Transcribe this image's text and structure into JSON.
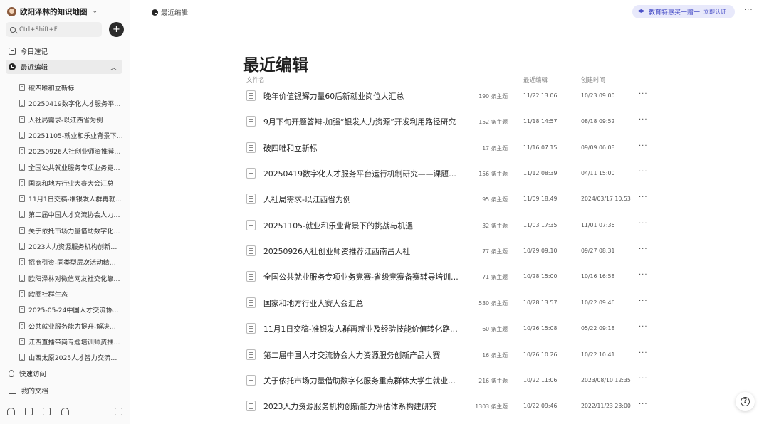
{
  "sidebar": {
    "workspace_name": "欧阳泽林的知识地图",
    "search_placeholder": "Ctrl+Shift+F",
    "add_label": "+",
    "nav": {
      "today": "今日速记",
      "recent": "最近编辑"
    },
    "tree": [
      "破四唯和立新标",
      "20250419数字化人才服务平…",
      "人社局需求-以江西省为例",
      "20251105-就业和乐业背景下…",
      "20250926人社创业师资推荐…",
      "全国公共就业服务专项业务竞…",
      "国家和地方行业大赛大会汇总",
      "11月1日交稿-准银发人群再就…",
      "第二届中国人才交流协会人力…",
      "关于依托市场力量借助数字化…",
      "2023人力资源服务机构创新…",
      "招商引资-同类型层次活动精…",
      "欧阳泽林对微信网友社交化靠…",
      "欧圈社群生态",
      "2025-05-24中国人才交流协…",
      "公共就业服务能力提升-解决…",
      "江西直播带岗专题培训师资推…",
      "山西太原2025人才智力交流…"
    ],
    "quick_access": "快速访问",
    "my_docs": "我的文档"
  },
  "header": {
    "breadcrumb": "最近编辑",
    "promo_text": "教育特惠买一赠一",
    "promo_cta": "立即认证",
    "more": "···"
  },
  "main": {
    "title": "最近编辑",
    "columns": {
      "name": "文件名",
      "edited": "最近编辑",
      "created": "创建时间"
    },
    "rows": [
      {
        "name": "晚年价值银辉力量60后新就业岗位大汇总",
        "count": "190 条主题",
        "edited": "11/22 13:06",
        "created": "10/23 09:00"
      },
      {
        "name": "9月下旬开题答辩-加强“银发人力资源”开发利用路径研究",
        "count": "152 条主题",
        "edited": "11/18 14:57",
        "created": "08/18 09:52"
      },
      {
        "name": "破四唯和立新标",
        "count": "17 条主题",
        "edited": "11/16 07:15",
        "created": "09/09 06:08"
      },
      {
        "name": "20250419数字化人才服务平台运行机制研究——课题…",
        "count": "156 条主题",
        "edited": "11/12 08:39",
        "created": "04/11 15:00"
      },
      {
        "name": "人社局需求-以江西省为例",
        "count": "95 条主题",
        "edited": "11/09 18:49",
        "created": "2024/03/17 10:53"
      },
      {
        "name": "20251105-就业和乐业背景下的挑战与机遇",
        "count": "32 条主题",
        "edited": "11/03 17:35",
        "created": "11/01 07:36"
      },
      {
        "name": "20250926人社创业师资推荐江西南昌人社",
        "count": "77 条主题",
        "edited": "10/29 09:10",
        "created": "09/27 08:31"
      },
      {
        "name": "全国公共就业服务专项业务竞赛-省级竞赛备赛辅导培训…",
        "count": "71 条主题",
        "edited": "10/28 15:00",
        "created": "10/16 16:58"
      },
      {
        "name": "国家和地方行业大赛大会汇总",
        "count": "530 条主题",
        "edited": "10/28 13:57",
        "created": "10/22 09:46"
      },
      {
        "name": "11月1日交稿-准银发人群再就业及经验技能价值转化路…",
        "count": "60 条主题",
        "edited": "10/26 15:08",
        "created": "05/22 09:18"
      },
      {
        "name": "第二届中国人才交流协会人力资源服务创新产品大赛",
        "count": "16 条主题",
        "edited": "10/26 10:26",
        "created": "10/22 10:41"
      },
      {
        "name": "关于依托市场力量借助数字化服务重点群体大学生就业…",
        "count": "216 条主题",
        "edited": "10/22 11:06",
        "created": "2023/08/10 12:35"
      },
      {
        "name": "2023人力资源服务机构创新能力评估体系构建研究",
        "count": "1303 条主题",
        "edited": "10/22 09:46",
        "created": "2022/11/23 23:00"
      }
    ],
    "row_more": "···"
  },
  "help_label": "?"
}
